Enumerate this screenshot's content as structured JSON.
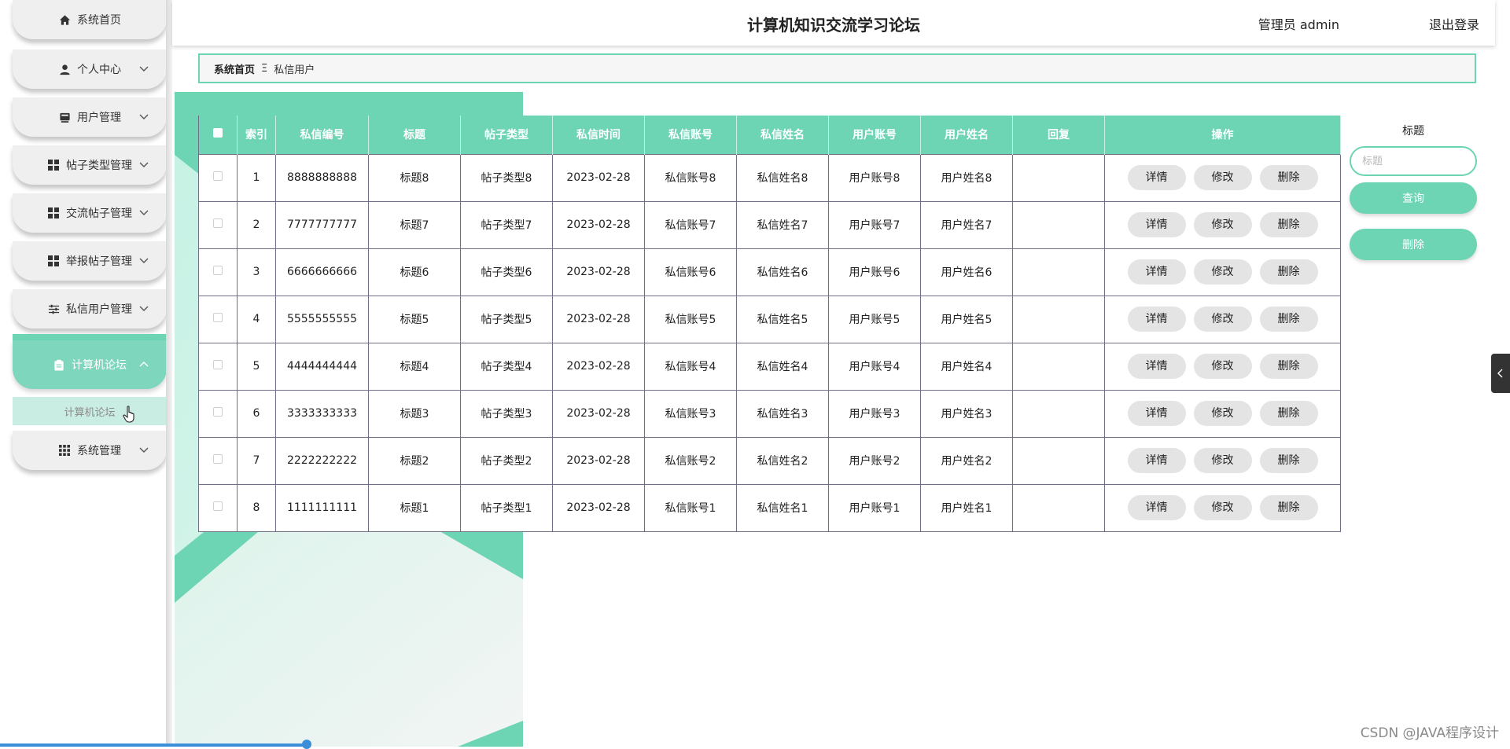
{
  "header": {
    "title": "计算机知识交流学习论坛",
    "user_label": "管理员 admin",
    "logout_label": "退出登录"
  },
  "sidebar": {
    "items": [
      {
        "label": "系统首页",
        "icon": "home-icon",
        "has_chevron": false
      },
      {
        "label": "个人中心",
        "icon": "person-icon",
        "has_chevron": true
      },
      {
        "label": "用户管理",
        "icon": "user-card-icon",
        "has_chevron": true
      },
      {
        "label": "帖子类型管理",
        "icon": "grid-icon",
        "has_chevron": true
      },
      {
        "label": "交流帖子管理",
        "icon": "grid-icon",
        "has_chevron": true
      },
      {
        "label": "举报帖子管理",
        "icon": "grid-icon",
        "has_chevron": true
      },
      {
        "label": "私信用户管理",
        "icon": "sliders-icon",
        "has_chevron": true
      },
      {
        "label": "计算机论坛",
        "icon": "clipboard-icon",
        "has_chevron": true,
        "active": true
      },
      {
        "label": "系统管理",
        "icon": "apps-icon",
        "has_chevron": true
      }
    ],
    "submenu_label": "计算机论坛",
    "accent_color": "#6dd4b4"
  },
  "breadcrumb": {
    "home": "系统首页",
    "separator": "Ξ",
    "current": "私信用户"
  },
  "table": {
    "columns": [
      "索引",
      "私信编号",
      "标题",
      "帖子类型",
      "私信时间",
      "私信账号",
      "私信姓名",
      "用户账号",
      "用户姓名",
      "回复",
      "操作"
    ],
    "rows": [
      {
        "index": "1",
        "no": "8888888888",
        "title": "标题8",
        "type": "帖子类型8",
        "time": "2023-02-28",
        "msg_account": "私信账号8",
        "msg_name": "私信姓名8",
        "user_account": "用户账号8",
        "user_name": "用户姓名8",
        "reply": ""
      },
      {
        "index": "2",
        "no": "7777777777",
        "title": "标题7",
        "type": "帖子类型7",
        "time": "2023-02-28",
        "msg_account": "私信账号7",
        "msg_name": "私信姓名7",
        "user_account": "用户账号7",
        "user_name": "用户姓名7",
        "reply": ""
      },
      {
        "index": "3",
        "no": "6666666666",
        "title": "标题6",
        "type": "帖子类型6",
        "time": "2023-02-28",
        "msg_account": "私信账号6",
        "msg_name": "私信姓名6",
        "user_account": "用户账号6",
        "user_name": "用户姓名6",
        "reply": ""
      },
      {
        "index": "4",
        "no": "5555555555",
        "title": "标题5",
        "type": "帖子类型5",
        "time": "2023-02-28",
        "msg_account": "私信账号5",
        "msg_name": "私信姓名5",
        "user_account": "用户账号5",
        "user_name": "用户姓名5",
        "reply": ""
      },
      {
        "index": "5",
        "no": "4444444444",
        "title": "标题4",
        "type": "帖子类型4",
        "time": "2023-02-28",
        "msg_account": "私信账号4",
        "msg_name": "私信姓名4",
        "user_account": "用户账号4",
        "user_name": "用户姓名4",
        "reply": ""
      },
      {
        "index": "6",
        "no": "3333333333",
        "title": "标题3",
        "type": "帖子类型3",
        "time": "2023-02-28",
        "msg_account": "私信账号3",
        "msg_name": "私信姓名3",
        "user_account": "用户账号3",
        "user_name": "用户姓名3",
        "reply": ""
      },
      {
        "index": "7",
        "no": "2222222222",
        "title": "标题2",
        "type": "帖子类型2",
        "time": "2023-02-28",
        "msg_account": "私信账号2",
        "msg_name": "私信姓名2",
        "user_account": "用户账号2",
        "user_name": "用户姓名2",
        "reply": ""
      },
      {
        "index": "8",
        "no": "1111111111",
        "title": "标题1",
        "type": "帖子类型1",
        "time": "2023-02-28",
        "msg_account": "私信账号1",
        "msg_name": "私信姓名1",
        "user_account": "用户账号1",
        "user_name": "用户姓名1",
        "reply": ""
      }
    ],
    "actions": {
      "detail": "详情",
      "edit": "修改",
      "delete": "删除"
    }
  },
  "search": {
    "label": "标题",
    "placeholder": "标题",
    "value": "",
    "query_label": "查询",
    "delete_label": "删除"
  },
  "watermark": "CSDN @JAVA程序设计"
}
